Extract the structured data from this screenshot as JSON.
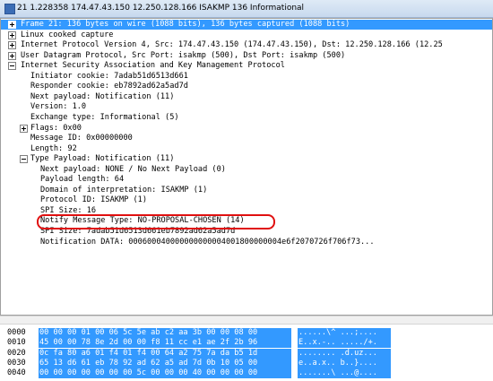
{
  "window": {
    "title": "21 1.228358 174.47.43.150 12.250.128.166 ISAKMP 136 Informational"
  },
  "tree": [
    {
      "text": "Frame 21: 136 bytes on wire (1088 bits), 136 bytes captured (1088 bits)",
      "expander": "plus",
      "indent": 0,
      "selected": true
    },
    {
      "text": "Linux cooked capture",
      "expander": "plus",
      "indent": 0
    },
    {
      "text": "Internet Protocol Version 4, Src: 174.47.43.150 (174.47.43.150), Dst: 12.250.128.166 (12.25",
      "expander": "plus",
      "indent": 0
    },
    {
      "text": "User Datagram Protocol, Src Port: isakmp (500), Dst Port: isakmp (500)",
      "expander": "plus",
      "indent": 0
    },
    {
      "text": "Internet Security Association and Key Management Protocol",
      "expander": "minus",
      "indent": 0
    },
    {
      "text": "Initiator cookie: 7adab51d6513d661",
      "expander": "",
      "indent": 1
    },
    {
      "text": "Responder cookie: eb7892ad62a5ad7d",
      "expander": "",
      "indent": 1
    },
    {
      "text": "Next payload: Notification (11)",
      "expander": "",
      "indent": 1
    },
    {
      "text": "Version: 1.0",
      "expander": "",
      "indent": 1
    },
    {
      "text": "Exchange type: Informational (5)",
      "expander": "",
      "indent": 1
    },
    {
      "text": "Flags: 0x00",
      "expander": "plus",
      "indent": 1
    },
    {
      "text": "Message ID: 0x00000000",
      "expander": "",
      "indent": 1
    },
    {
      "text": "Length: 92",
      "expander": "",
      "indent": 1
    },
    {
      "text": "Type Payload: Notification (11)",
      "expander": "minus",
      "indent": 1
    },
    {
      "text": "Next payload: NONE / No Next Payload  (0)",
      "expander": "",
      "indent": 2
    },
    {
      "text": "Payload length: 64",
      "expander": "",
      "indent": 2
    },
    {
      "text": "Domain of interpretation: ISAKMP (1)",
      "expander": "",
      "indent": 2
    },
    {
      "text": "Protocol ID: ISAKMP (1)",
      "expander": "",
      "indent": 2
    },
    {
      "text": "SPI Size: 16",
      "expander": "",
      "indent": 2
    },
    {
      "text": "Notify Message Type: NO-PROPOSAL-CHOSEN (14)",
      "expander": "",
      "indent": 2
    },
    {
      "text": "SPI Size: 7adab51d6513d661eb7892ad62a5ad7d",
      "expander": "",
      "indent": 2
    },
    {
      "text": "Notification DATA: 000600040000000000004001800000004e6f2070726f706f73...",
      "expander": "",
      "indent": 2
    }
  ],
  "hex": [
    {
      "offset": "0000",
      "bytes": "00 00 00 01 00 06 5c 5e  ab c2 aa 3b 00 00 08 00",
      "ascii": "......\\^ ...;...."
    },
    {
      "offset": "0010",
      "bytes": "45 00 00 78 8e 2d 00 00  f8 11 cc e1 ae 2f 2b 96",
      "ascii": "E..x.-.. ...../+."
    },
    {
      "offset": "0020",
      "bytes": "0c fa 80 a6 01 f4 01 f4  00 64 a2 75 7a da b5 1d",
      "ascii": "........ .d.uz..."
    },
    {
      "offset": "0030",
      "bytes": "65 13 d6 61 eb 78 92 ad  62 a5 ad 7d 0b 10 05 00",
      "ascii": "e..a.x.. b..}...."
    },
    {
      "offset": "0040",
      "bytes": "00 00 00 00 00 00 00 5c  00 00 00 40 00 00 00 00",
      "ascii": ".......\\ ...@...."
    }
  ]
}
